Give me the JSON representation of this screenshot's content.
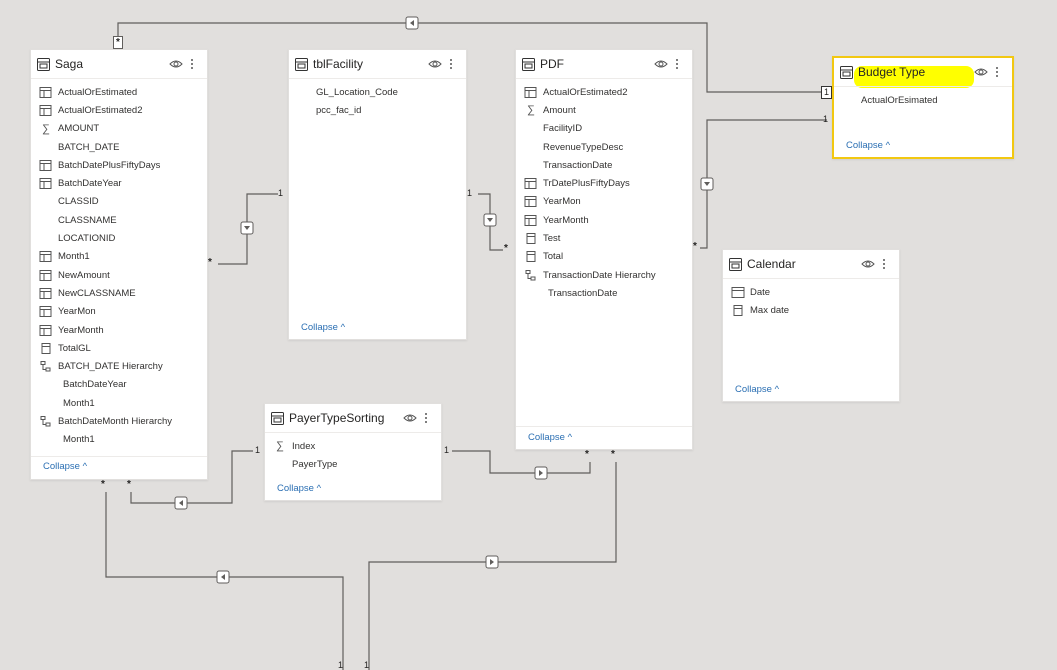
{
  "tables": {
    "saga": {
      "title": "Saga",
      "collapse": "Collapse",
      "fields": [
        "ActualOrEstimated",
        "ActualOrEstimated2",
        "AMOUNT",
        "BATCH_DATE",
        "BatchDatePlusFiftyDays",
        "BatchDateYear",
        "CLASSID",
        "CLASSNAME",
        "LOCATIONID",
        "Month1",
        "NewAmount",
        "NewCLASSNAME",
        "YearMon",
        "YearMonth",
        "TotalGL",
        "BATCH_DATE Hierarchy",
        "BatchDateYear",
        "Month1",
        "BatchDateMonth Hierarchy",
        "Month1"
      ]
    },
    "tblfacility": {
      "title": "tblFacility",
      "collapse": "Collapse",
      "fields": [
        "GL_Location_Code",
        "pcc_fac_id"
      ]
    },
    "pdf": {
      "title": "PDF",
      "collapse": "Collapse",
      "fields": [
        "ActualOrEstimated2",
        "Amount",
        "FacilityID",
        "RevenueTypeDesc",
        "TransactionDate",
        "TrDatePlusFiftyDays",
        "YearMon",
        "YearMonth",
        "Test",
        "Total",
        "TransactionDate Hierarchy",
        "TransactionDate"
      ]
    },
    "budget_type": {
      "title": "Budget Type",
      "collapse": "Collapse",
      "fields": [
        "ActualOrEsimated"
      ]
    },
    "calendar": {
      "title": "Calendar",
      "collapse": "Collapse",
      "fields": [
        "Date",
        "Max date"
      ]
    },
    "payertypesorting": {
      "title": "PayerTypeSorting",
      "collapse": "Collapse",
      "fields": [
        "Index",
        "PayerType"
      ]
    }
  },
  "cardinality": {
    "one": "1",
    "many": "*"
  },
  "colors": {
    "highlight": "#ffff00",
    "selected_border": "#f2c811",
    "link": "#2b6fb3",
    "line": "#605e5c"
  }
}
